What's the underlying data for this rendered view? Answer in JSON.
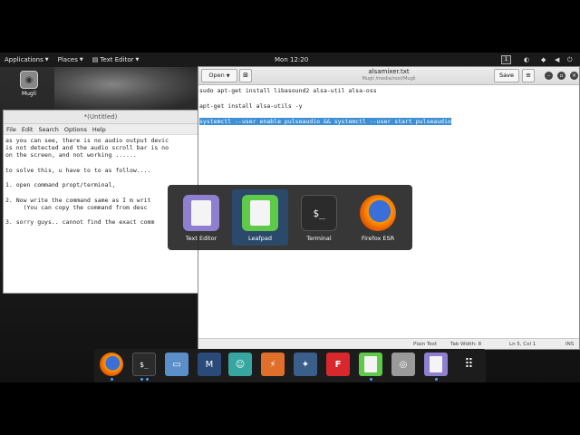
{
  "topbar": {
    "applications": "Applications",
    "places": "Places",
    "text_editor": "Text Editor",
    "clock": "Mon 12:20",
    "workspace": "1"
  },
  "desktop": {
    "icon_label": "Mugli"
  },
  "left_window": {
    "title": "*(Untitled)",
    "menu": [
      "File",
      "Edit",
      "Search",
      "Options",
      "Help"
    ],
    "text": "as you can see, there is no audio output devic\nis not detected and the audio scroll bar is no\non the screen, and not working ......\n\nto solve this, u have to to as follow....\n\n1. open command propt/terminal,\n\n2. Now write the command same as I m writ\n     (You can copy the command from desc\n\n3. sorry guys.. cannot find the exact comm"
  },
  "right_window": {
    "open_label": "Open",
    "filename": "alsamixer.txt",
    "path": "Mugli /media/root/Mugli",
    "save_label": "Save",
    "line1": "sudo apt-get install libasound2 alsa-util alsa-oss",
    "line2": "",
    "line3": "apt-get install alsa-utils -y",
    "line4": "",
    "line5_selected": "systemctl --user enable pulseaudio && systemctl --user start pulseaudio",
    "status_lang": "Plain Text",
    "status_tab": "Tab Width: 8",
    "status_pos": "Ln 5, Col 1",
    "status_ins": "INS"
  },
  "switcher": {
    "items": [
      {
        "label": "Text Editor",
        "icon": "text-editor-icon",
        "color": "#8f7fd1"
      },
      {
        "label": "Leafpad",
        "icon": "leafpad-icon",
        "color": "#5fc94a"
      },
      {
        "label": "Terminal",
        "icon": "terminal-icon",
        "color": "#2b2b2b"
      },
      {
        "label": "Firefox ESR",
        "icon": "firefox-icon",
        "color": "#e66000"
      }
    ],
    "active_index": 1
  },
  "dock": {
    "items": [
      {
        "icon": "firefox-icon",
        "color": "#e66000",
        "running": true
      },
      {
        "icon": "terminal-icon",
        "color": "#2b2b2b",
        "running": true
      },
      {
        "icon": "files-icon",
        "color": "#5b8fc9",
        "running": false
      },
      {
        "icon": "metasploit-icon",
        "color": "#2a4a7a",
        "running": false
      },
      {
        "icon": "armitage-icon",
        "color": "#37a6a0",
        "running": false
      },
      {
        "icon": "burpsuite-icon",
        "color": "#e06f2c",
        "running": false
      },
      {
        "icon": "maltego-icon",
        "color": "#3a5f8a",
        "running": false
      },
      {
        "icon": "faraday-icon",
        "color": "#d9272e",
        "running": false
      },
      {
        "icon": "leafpad-icon",
        "color": "#5fc94a",
        "running": true
      },
      {
        "icon": "cherrytree-icon",
        "color": "#9a9a9a",
        "running": false
      },
      {
        "icon": "text-editor-icon",
        "color": "#8f7fd1",
        "running": true
      },
      {
        "icon": "show-apps-icon",
        "color": "#1c1c1c",
        "running": false
      }
    ]
  }
}
